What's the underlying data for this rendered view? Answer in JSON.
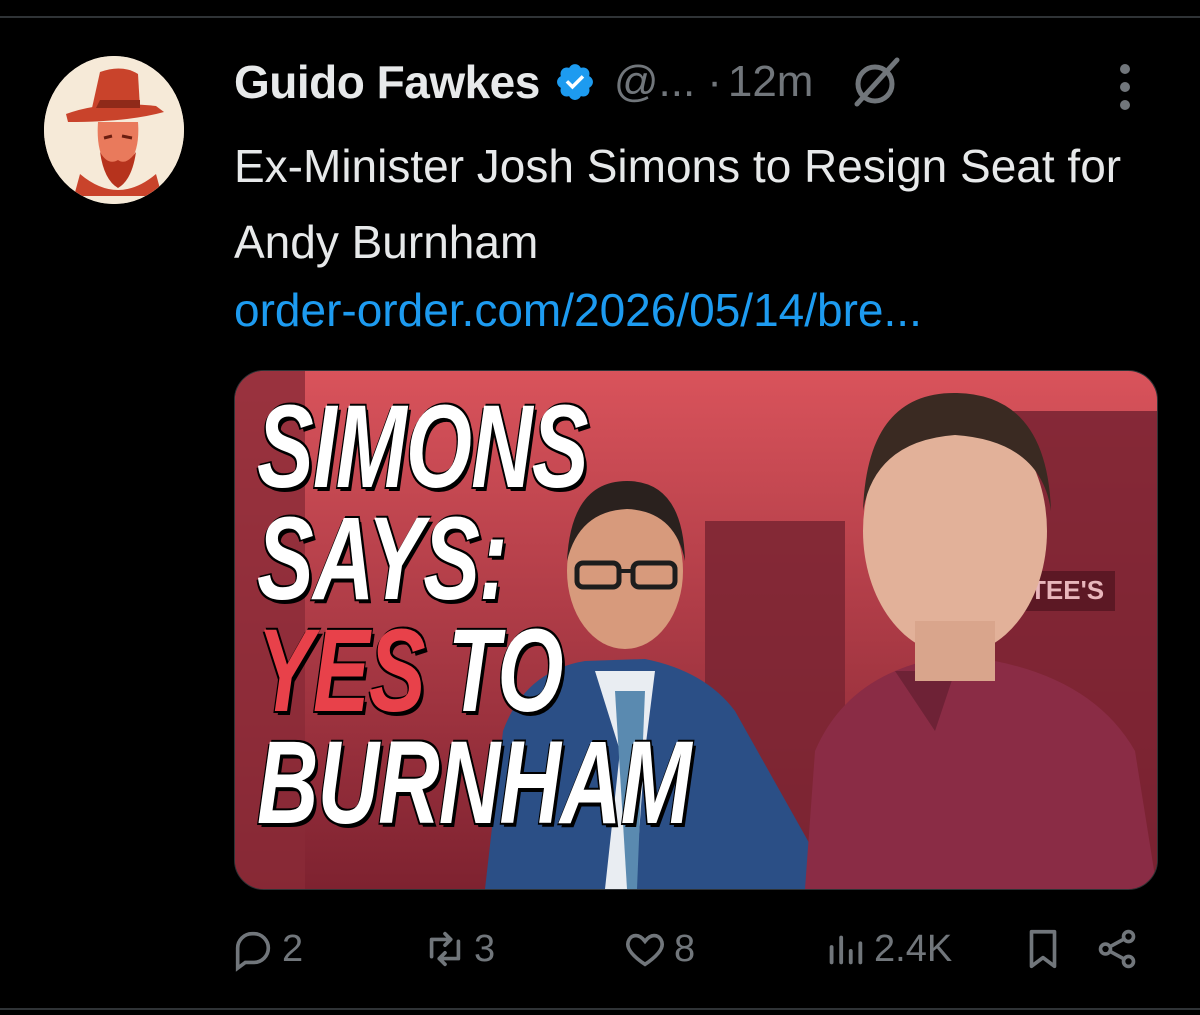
{
  "tweet": {
    "author_name": "Guido Fawkes",
    "handle": "@...",
    "separator": "·",
    "time": "12m",
    "text": "Ex-Minister Josh Simons to Resign Seat for Andy Burnham",
    "link": "order-order.com/2026/05/14/bre...",
    "media": {
      "headline_line1": "SIMONS",
      "headline_line2": "SAYS:",
      "headline_line3a": "YES",
      "headline_line3b": " TO",
      "headline_line4": "BURNHAM",
      "shop_sign": "TEE'S"
    }
  },
  "actions": {
    "replies": "2",
    "reposts": "3",
    "likes": "8",
    "views": "2.4K"
  },
  "colors": {
    "link": "#1d9bf0",
    "verified": "#1d9bf0",
    "muted": "#71767b",
    "headline_accent": "#e8414a"
  },
  "icons": [
    "avatar",
    "verified-badge-icon",
    "grok-icon",
    "more-icon",
    "reply-icon",
    "repost-icon",
    "like-icon",
    "views-icon",
    "bookmark-icon",
    "share-icon"
  ]
}
